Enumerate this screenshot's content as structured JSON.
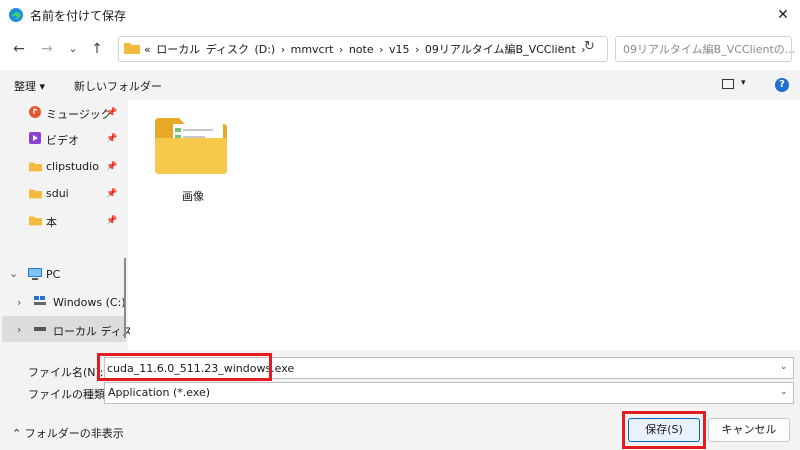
{
  "window": {
    "title": "名前を付けて保存",
    "close": "✕"
  },
  "nav": {
    "back": "←",
    "forward": "→",
    "recent": "⌄",
    "up": "↑",
    "address_path": "« ローカル ディスク (D:) › mmvcrt › note › v15 › 09リアルタイム編B_VCClient ›",
    "search_placeholder": "09リアルタイム編B_VCClientの...",
    "address_chevron": "⌄",
    "refresh": "↻"
  },
  "toolbar": {
    "organize": "整理 ▾",
    "new_folder": "新しいフォルダー",
    "view_chevron": "▾",
    "help": "?"
  },
  "sidebar": {
    "items": [
      {
        "label": "ミュージック",
        "icon": "music-icon",
        "pin": "📌"
      },
      {
        "label": "ビデオ",
        "icon": "video-icon",
        "pin": "📌"
      },
      {
        "label": "clipstudio",
        "icon": "folder-icon",
        "pin": "📌"
      },
      {
        "label": "sdui",
        "icon": "folder-icon",
        "pin": "📌"
      },
      {
        "label": "本",
        "icon": "folder-icon",
        "pin": "📌"
      }
    ],
    "pc": {
      "label": "PC",
      "chevron": "⌄"
    },
    "drives": [
      {
        "label": "Windows (C:)",
        "chevron": "›"
      },
      {
        "label": "ローカル ディスク",
        "chevron": "›"
      }
    ]
  },
  "main": {
    "items": [
      {
        "label": "画像",
        "icon": "folder-icon"
      }
    ]
  },
  "bottom": {
    "filename_label": "ファイル名(N):",
    "filename_value": "cuda_11.6.0_511.23_windows.exe",
    "filetype_label": "ファイルの種類(T):",
    "filetype_value": "Application (*.exe)",
    "hide_folders": "⌃  フォルダーの非表示",
    "save": "保存(S)",
    "cancel": "キャンセル",
    "dropdown": "⌄"
  },
  "colors": {
    "highlight": "#e31b23",
    "accent": "#0067c0",
    "folder": "#f4b93f"
  }
}
